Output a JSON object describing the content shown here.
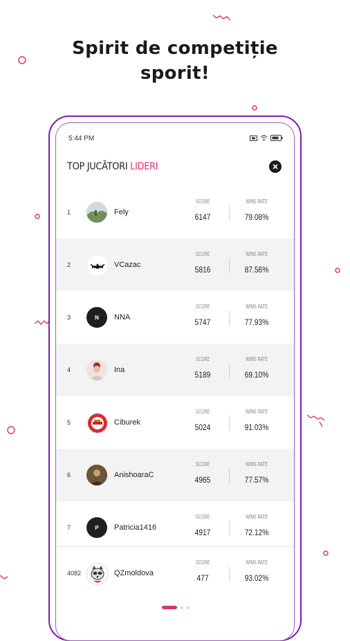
{
  "headline": {
    "line1": "Spirit de competiție",
    "line2": "sporit!"
  },
  "status_bar": {
    "time": "5:44 PM"
  },
  "leaderboard": {
    "title_prefix": "TOP JUCĂTORI",
    "title_accent": "LIDERI",
    "score_header": "SCORE",
    "wins_header": "WINS RATE",
    "rows": [
      {
        "rank": "1",
        "name": "Fely",
        "score": "6147",
        "wins_rate": "79.08%",
        "avatar_initial": ""
      },
      {
        "rank": "2",
        "name": "VCazac",
        "score": "5816",
        "wins_rate": "87.56%",
        "avatar_initial": ""
      },
      {
        "rank": "3",
        "name": "NNA",
        "score": "5747",
        "wins_rate": "77.93%",
        "avatar_initial": "N"
      },
      {
        "rank": "4",
        "name": "Ina",
        "score": "5189",
        "wins_rate": "69.10%",
        "avatar_initial": ""
      },
      {
        "rank": "5",
        "name": "Ciburek",
        "score": "5024",
        "wins_rate": "91.03%",
        "avatar_initial": ""
      },
      {
        "rank": "6",
        "name": "AnishoaraC",
        "score": "4965",
        "wins_rate": "77.57%",
        "avatar_initial": ""
      },
      {
        "rank": "7",
        "name": "Patricia1416",
        "score": "4917",
        "wins_rate": "72.12%",
        "avatar_initial": "P"
      },
      {
        "rank": "4082",
        "name": "QZmoldova",
        "score": "477",
        "wins_rate": "93.02%",
        "avatar_initial": ""
      }
    ]
  },
  "colors": {
    "accent": "#e0306a",
    "frame": "#7b1fa2"
  }
}
